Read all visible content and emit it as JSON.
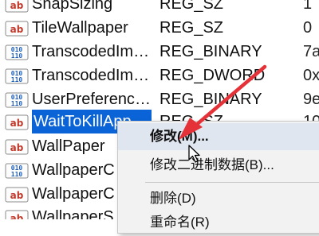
{
  "rows": [
    {
      "icon": "string-value-icon",
      "name": "SnapSizing",
      "type": "REG_SZ",
      "data": "1"
    },
    {
      "icon": "string-value-icon",
      "name": "TileWallpaper",
      "type": "REG_SZ",
      "data": "0"
    },
    {
      "icon": "binary-value-icon",
      "name": "TranscodedIma...",
      "type": "REG_BINARY",
      "data": "7a"
    },
    {
      "icon": "binary-value-icon",
      "name": "TranscodedIma...",
      "type": "REG_DWORD",
      "data": "0x"
    },
    {
      "icon": "binary-value-icon",
      "name": "UserPreference...",
      "type": "REG_BINARY",
      "data": "9e"
    },
    {
      "icon": "string-value-icon",
      "name": "WaitToKillAppT...",
      "type": "REG_SZ",
      "data": "10"
    },
    {
      "icon": "string-value-icon",
      "name": "WallPaper",
      "type": "",
      "data": ""
    },
    {
      "icon": "binary-value-icon",
      "name": "WallpaperC",
      "type": "",
      "data": ""
    },
    {
      "icon": "string-value-icon",
      "name": "WallpaperC",
      "type": "",
      "data": ""
    },
    {
      "icon": "string-value-icon",
      "name": "WallpaperS",
      "type": "",
      "data": ""
    }
  ],
  "context_menu": {
    "modify": "修改(M)...",
    "modify_binary": "修改二进制数据(B)...",
    "delete": "删除(D)",
    "rename": "重命名(R)"
  },
  "colors": {
    "selection": "#0a64d8",
    "annotation_arrow": "#e53238",
    "string_icon": "#c0392b",
    "binary_icon": "#1f5fb5"
  }
}
